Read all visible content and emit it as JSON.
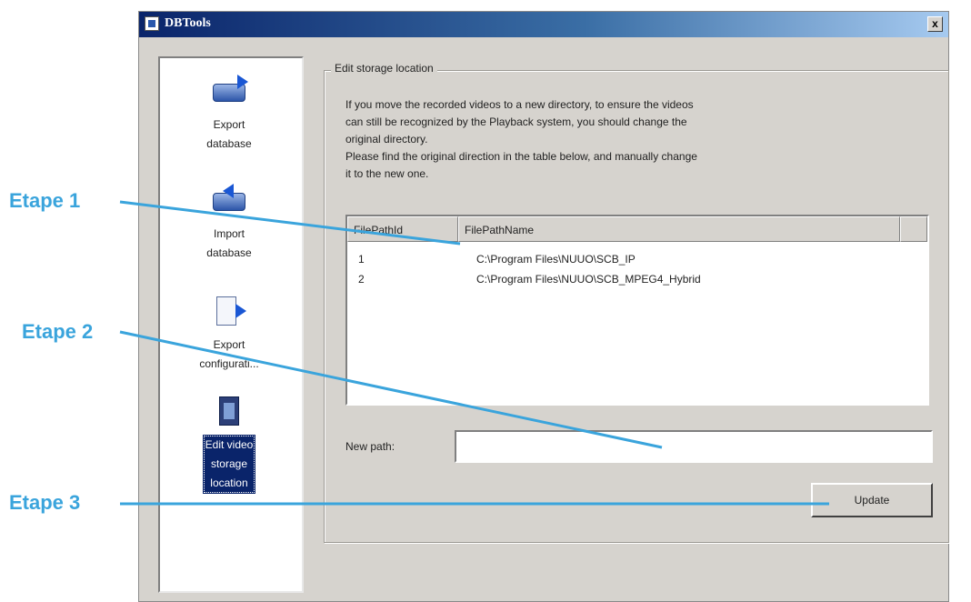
{
  "window": {
    "title": "DBTools",
    "close_glyph": "x"
  },
  "sidebar": {
    "items": [
      {
        "label": "Export\ndatabase",
        "icon": "export-database-icon",
        "selected": false
      },
      {
        "label": "Import\ndatabase",
        "icon": "import-database-icon",
        "selected": false
      },
      {
        "label": "Export\nconfigurati...",
        "icon": "export-configuration-icon",
        "selected": false
      },
      {
        "label": "Edit video\nstorage\nlocation",
        "icon": "video-storage-icon",
        "selected": true
      }
    ]
  },
  "main": {
    "group_title": "Edit storage location",
    "description": [
      "If you move the recorded videos to a new directory, to ensure the videos",
      "can still be recognized by the Playback system, you should change the",
      "original directory.",
      "Please find the original direction in the table below, and manually change",
      "it to the new one."
    ],
    "table": {
      "columns": [
        "FilePathId",
        "FilePathName"
      ],
      "rows": [
        {
          "id": "1",
          "name": "C:\\Program Files\\NUUO\\SCB_IP"
        },
        {
          "id": "2",
          "name": "C:\\Program Files\\NUUO\\SCB_MPEG4_Hybrid"
        }
      ]
    },
    "new_path_label": "New path:",
    "new_path_value": "",
    "update_label": "Update"
  },
  "annotations": {
    "step1": "Etape 1",
    "step2": "Etape 2",
    "step3": "Etape 3",
    "color": "#3aa4dc"
  }
}
